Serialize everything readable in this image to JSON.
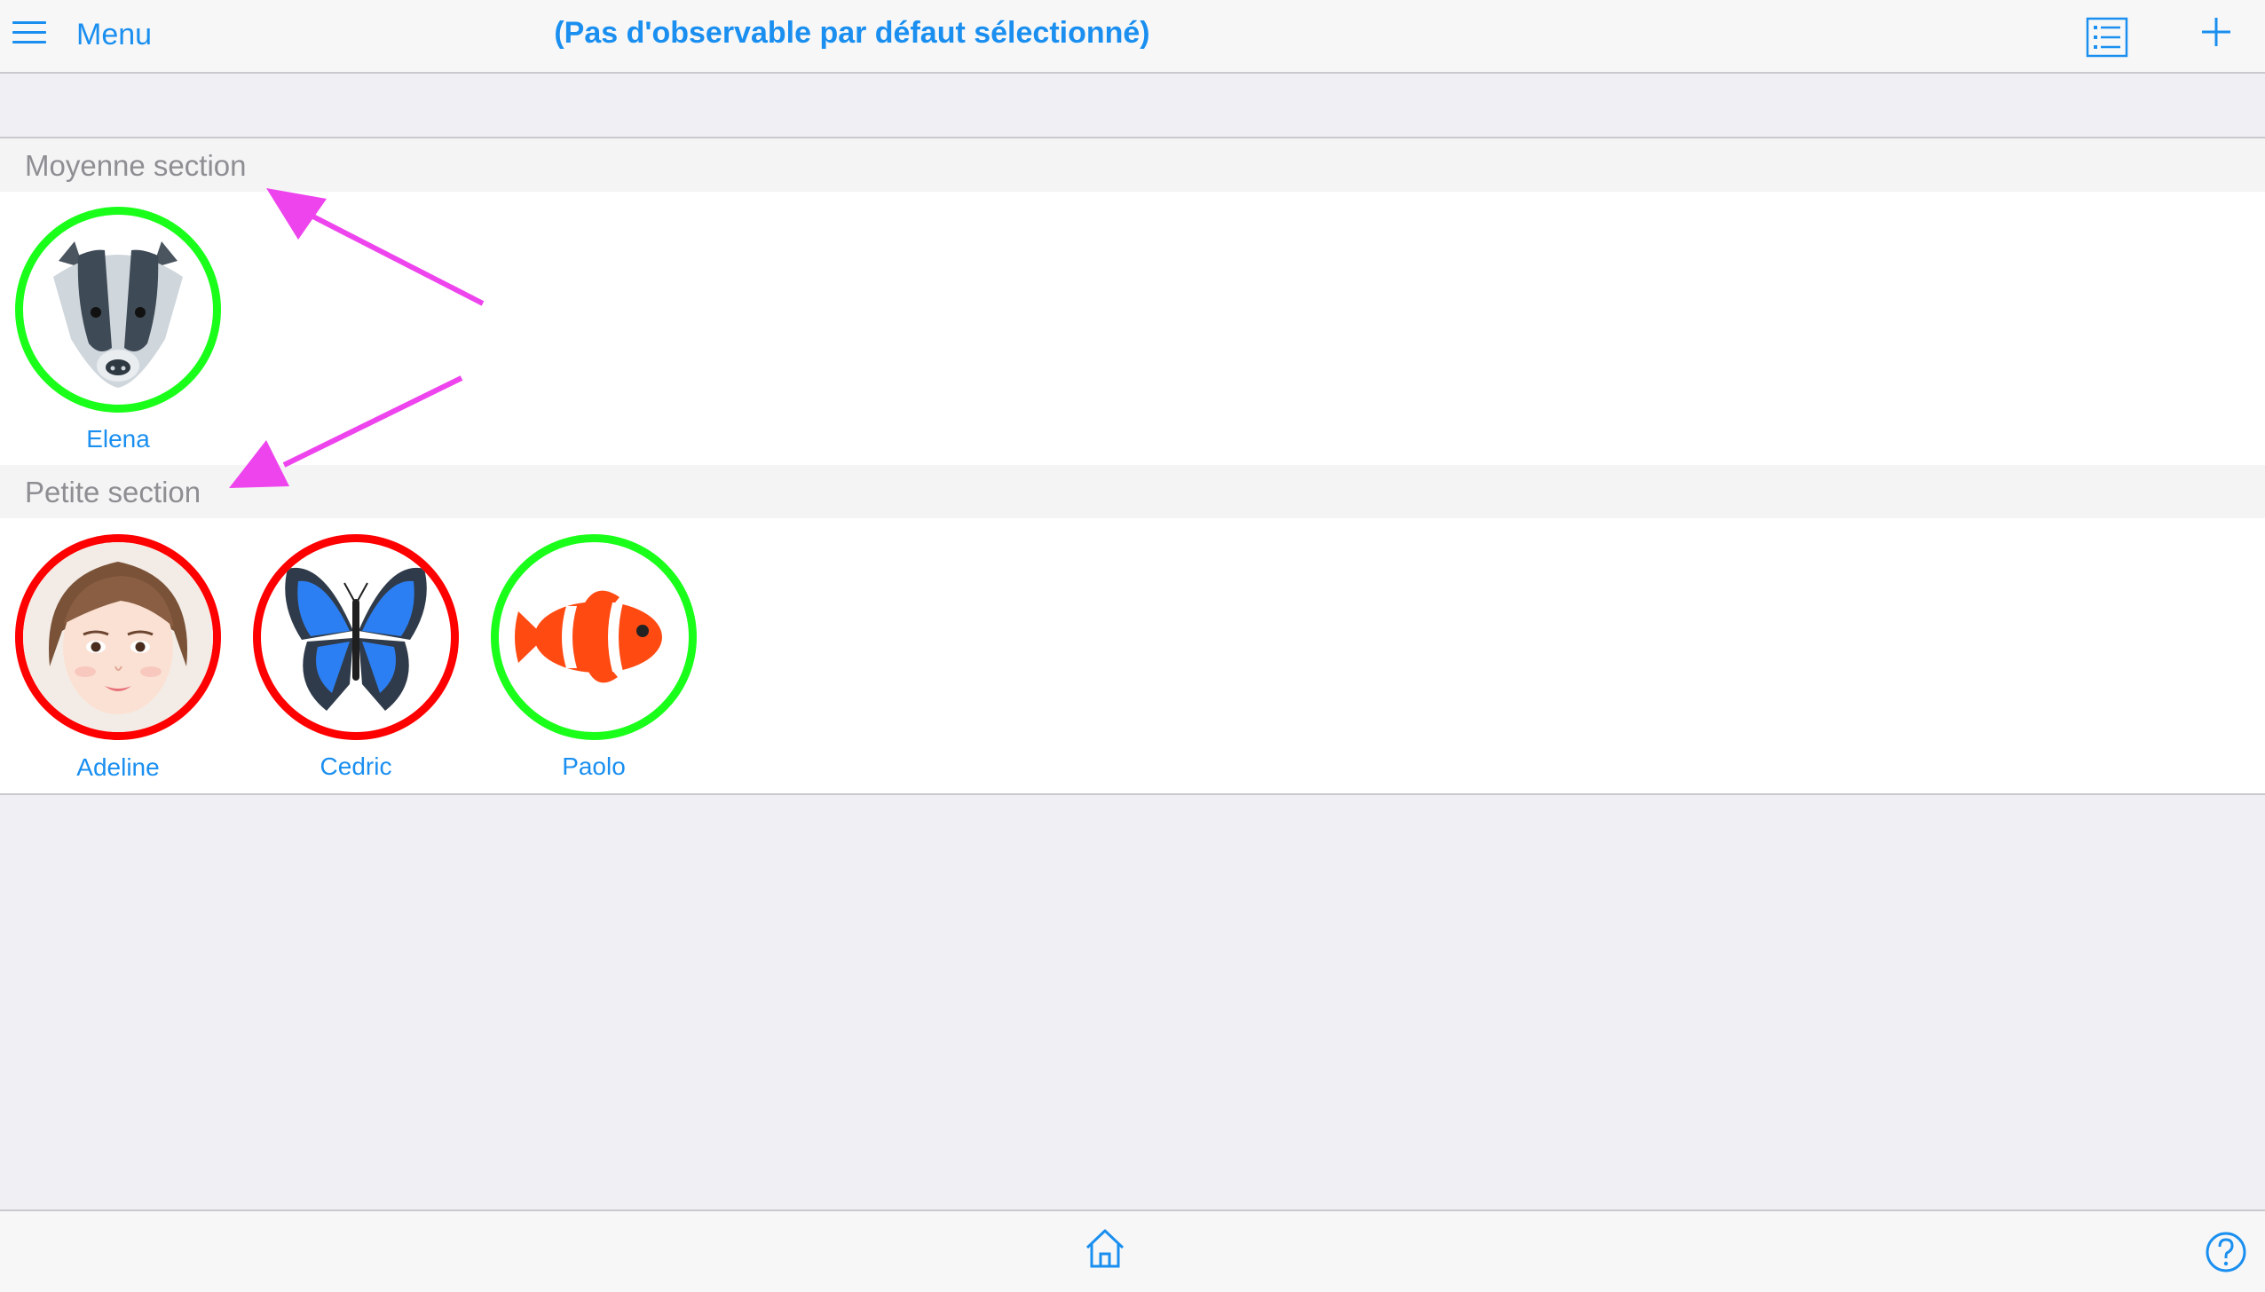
{
  "header": {
    "menu_label": "Menu",
    "title": "(Pas d'observable par défaut sélectionné)",
    "icons": [
      "hamburger-icon",
      "list-icon",
      "plus-icon"
    ]
  },
  "sections": [
    {
      "label": "Moyenne section",
      "students": [
        {
          "name": "Elena",
          "avatar": "badger",
          "status": "green"
        }
      ]
    },
    {
      "label": "Petite section",
      "students": [
        {
          "name": "Adeline",
          "avatar": "girl-face",
          "status": "red"
        },
        {
          "name": "Cedric",
          "avatar": "butterfly",
          "status": "red"
        },
        {
          "name": "Paolo",
          "avatar": "clownfish",
          "status": "green"
        }
      ]
    }
  ],
  "footer": {
    "icons": [
      "home-icon",
      "help-icon"
    ]
  },
  "colors": {
    "accent": "#1a8ff0",
    "status_green": "#1aff1a",
    "status_red": "#ff0000",
    "annotation_arrow": "#ee44ee"
  }
}
